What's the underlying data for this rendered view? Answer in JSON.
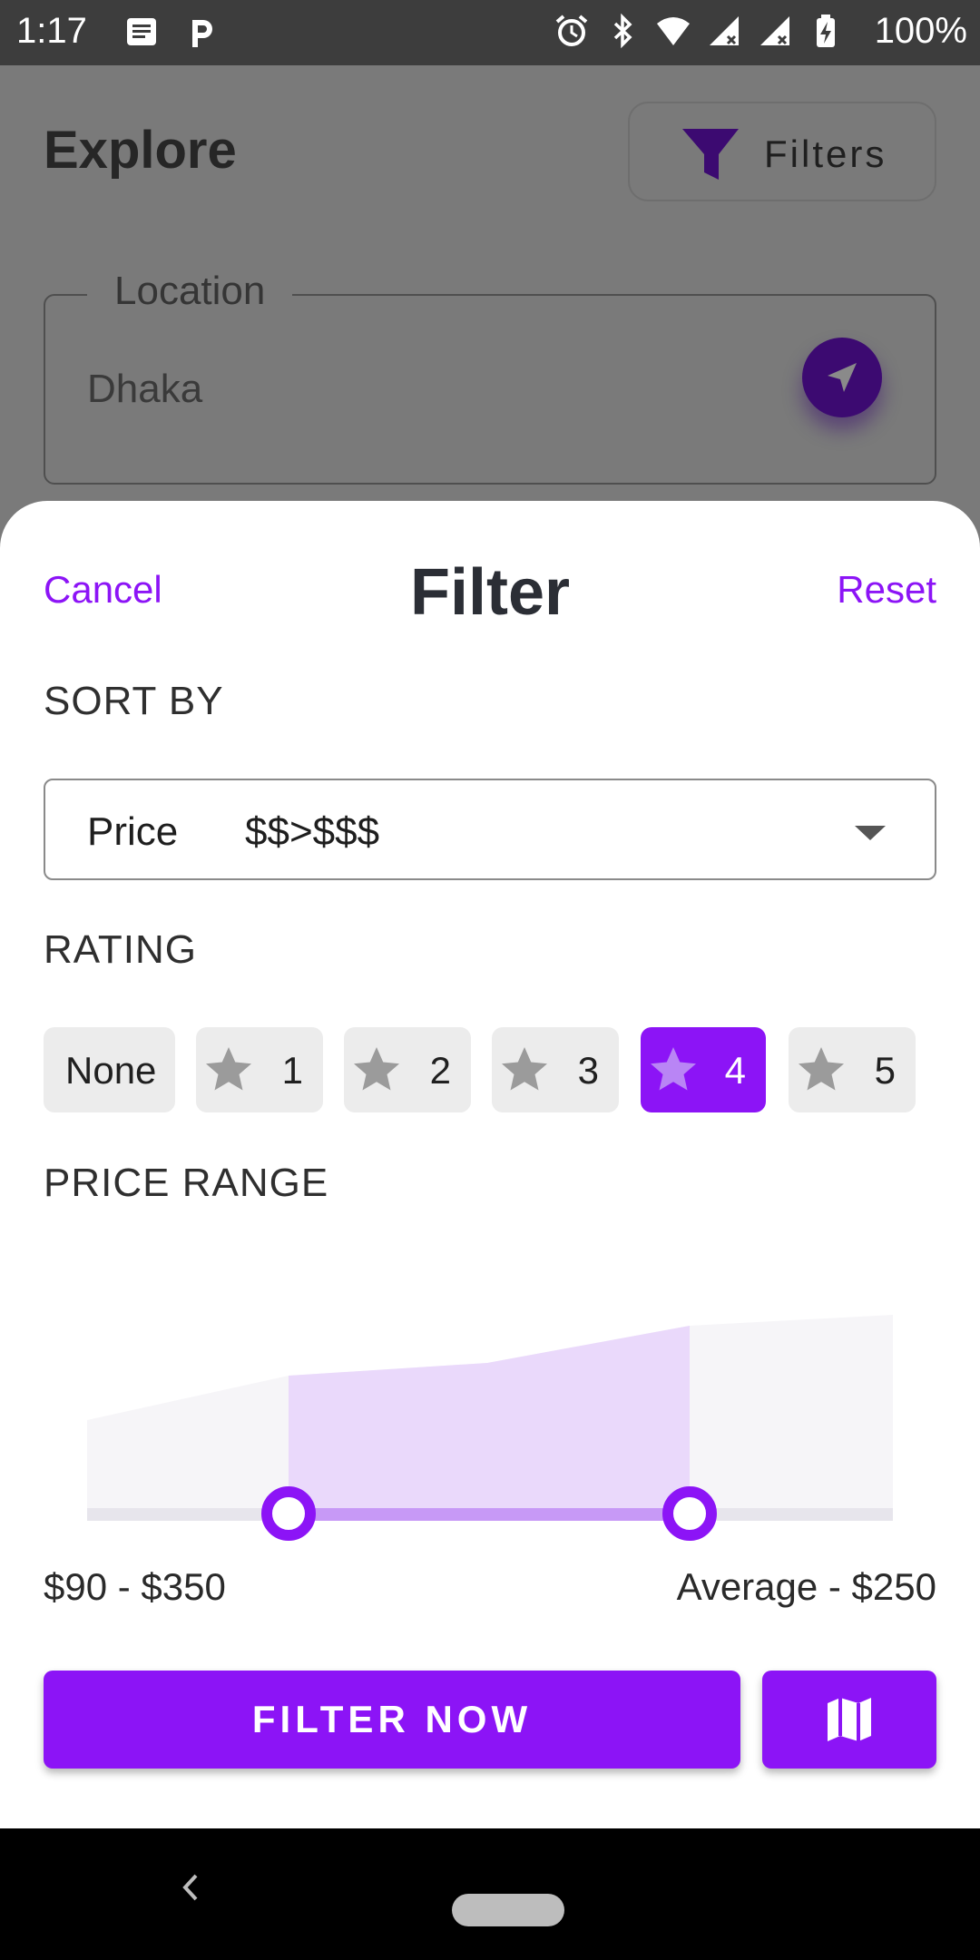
{
  "status_bar": {
    "time": "1:17",
    "battery": "100%"
  },
  "background": {
    "title": "Explore",
    "filters_label": "Filters",
    "location_label": "Location",
    "location_value": "Dhaka"
  },
  "sheet": {
    "cancel": "Cancel",
    "title": "Filter",
    "reset": "Reset",
    "sort_by_label": "SORT BY",
    "sort_key": "Price",
    "sort_value": "$$>$$$",
    "rating_label": "RATING",
    "rating_options": [
      "None",
      "1",
      "2",
      "3",
      "4",
      "5"
    ],
    "rating_selected": "4",
    "price_range_label": "PRICE RANGE",
    "price_range_value": "$90 - $350",
    "price_average": "Average - $250",
    "filter_now": "FILTER NOW"
  },
  "colors": {
    "accent": "#8c14f6",
    "text_dark": "#2b2e35",
    "chip_bg": "#ececec"
  }
}
